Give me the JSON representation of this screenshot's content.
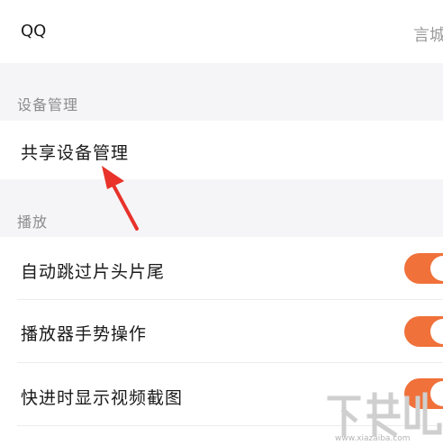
{
  "account": {
    "label": "QQ",
    "value": "言城"
  },
  "device_section": {
    "header": "设备管理",
    "items": [
      {
        "label": "共享设备管理"
      }
    ]
  },
  "play_section": {
    "header": "播放",
    "items": [
      {
        "label": "自动跳过片头片尾",
        "enabled": true
      },
      {
        "label": "播放器手势操作",
        "enabled": true
      },
      {
        "label": "快进时显示视频截图",
        "enabled": true
      }
    ]
  },
  "colors": {
    "toggle_on": "#f0713a",
    "annotation_arrow": "#e8322a"
  },
  "watermark": {
    "logo_text": "下载吧",
    "url": "www.xiazaiba.com"
  }
}
